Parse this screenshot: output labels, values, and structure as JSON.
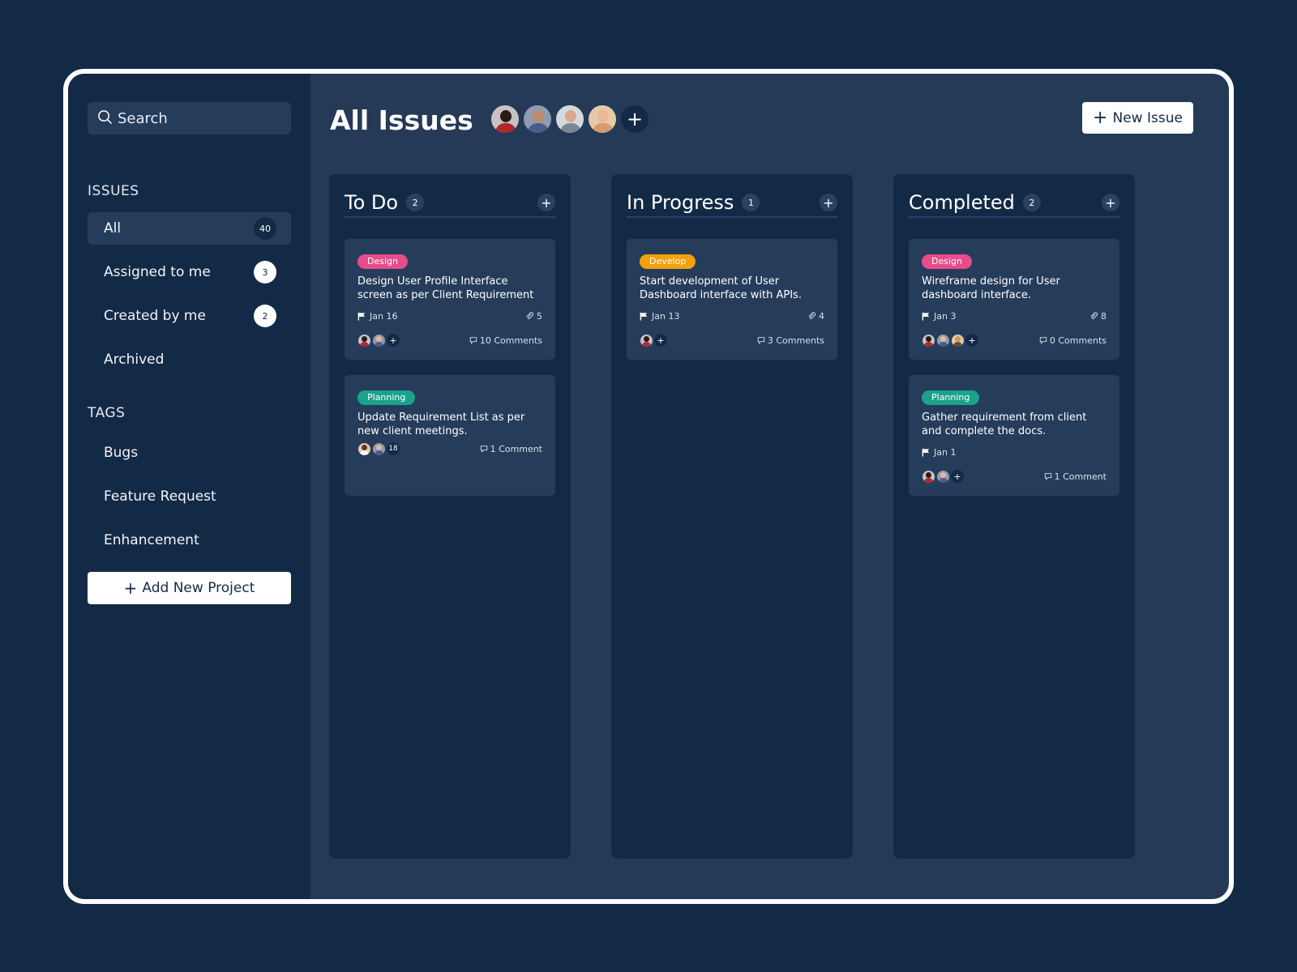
{
  "search": {
    "placeholder": "Search"
  },
  "sidebar": {
    "issues_label": "ISSUES",
    "issues": [
      {
        "label": "All",
        "count": "40",
        "active": true
      },
      {
        "label": "Assigned to me",
        "count": "3"
      },
      {
        "label": "Created by me",
        "count": "2"
      },
      {
        "label": "Archived"
      }
    ],
    "tags_label": "TAGS",
    "tags": [
      {
        "label": "Bugs"
      },
      {
        "label": "Feature Request"
      },
      {
        "label": "Enhancement"
      }
    ],
    "add_project": "Add New Project"
  },
  "header": {
    "title": "All Issues",
    "new_issue": "New Issue",
    "avatar_add": "+"
  },
  "colors": {
    "background": "#132a47",
    "panel": "#243a57",
    "card": "#253d5b",
    "tag_design": "#e84c8b",
    "tag_develop": "#f5a00c",
    "tag_planning": "#1aa38c"
  },
  "columns": [
    {
      "title": "To Do",
      "count": "2",
      "cards": [
        {
          "tag": "Design",
          "tag_color": "#e84c8b",
          "title": "Design User Profile Interface screen as per Client Requirement",
          "date": "Jan 16",
          "attachments": "5",
          "comments": "10 Comments"
        },
        {
          "tag": "Planning",
          "tag_color": "#1aa38c",
          "title": "Update Requirement List as per new client meetings.",
          "date": "",
          "attachments": "",
          "comments": "1 Comment",
          "avatar_extra": "18"
        }
      ]
    },
    {
      "title": "In Progress",
      "count": "1",
      "cards": [
        {
          "tag": "Develop",
          "tag_color": "#f5a00c",
          "title": "Start development of User Dashboard interface with APIs.",
          "date": "Jan 13",
          "attachments": "4",
          "comments": "3 Comments"
        }
      ]
    },
    {
      "title": "Completed",
      "count": "2",
      "cards": [
        {
          "tag": "Design",
          "tag_color": "#e84c8b",
          "title": "Wireframe design for User dashboard interface.",
          "date": "Jan 3",
          "attachments": "8",
          "comments": "0 Comments"
        },
        {
          "tag": "Planning",
          "tag_color": "#1aa38c",
          "title": "Gather requirement from client and complete the docs.",
          "date": "Jan 1",
          "attachments": "",
          "comments": "1 Comment"
        }
      ]
    }
  ]
}
